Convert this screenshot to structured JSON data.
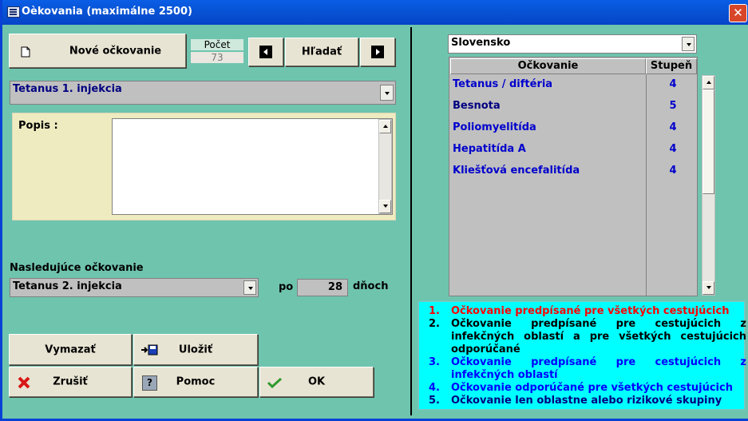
{
  "window": {
    "title": "Oèkovania (maximálne 2500)",
    "close_glyph": "✕"
  },
  "toolbar": {
    "new_label": "Nové očkovanie",
    "count_label": "Počet",
    "count_value": "73",
    "search_label": "Hľadať"
  },
  "vaccine_combo": {
    "value": "Tetanus 1. injekcia"
  },
  "description": {
    "label": "Popis :",
    "value": ""
  },
  "next": {
    "label": "Nasledujúce očkovanie",
    "value": "Tetanus 2. injekcia",
    "after_label": "po",
    "days_value": "28",
    "days_unit": "dňoch"
  },
  "buttons": {
    "delete": "Vymazať",
    "save": "Uložiť",
    "cancel": "Zrušiť",
    "help": "Pomoc",
    "ok": "OK"
  },
  "country_combo": {
    "value": "Slovensko"
  },
  "table": {
    "columns": [
      "Očkovanie",
      "Stupeň"
    ],
    "rows": [
      {
        "name": "Tetanus / diftéria",
        "degree": "4",
        "color": "#0000cc"
      },
      {
        "name": "Besnota",
        "degree": "5",
        "color": "#000080"
      },
      {
        "name": "Poliomyelitída",
        "degree": "4",
        "color": "#0000cc"
      },
      {
        "name": "Hepatitída A",
        "degree": "4",
        "color": "#0000cc"
      },
      {
        "name": "Kliešťová encefalitída",
        "degree": "4",
        "color": "#0000cc"
      }
    ]
  },
  "legend": [
    {
      "num": "1.",
      "text": "Očkovanie predpísané pre všetkých cestujúcich",
      "color": "#ff0000"
    },
    {
      "num": "2.",
      "text": "Očkovanie predpísané pre cestujúcich z infekčných oblastí a pre všetkých cestujúcich odporúčané",
      "color": "#000000"
    },
    {
      "num": "3.",
      "text": "Očkovanie predpísané pre cestujúcich z infekčných oblastí",
      "color": "#0000ff"
    },
    {
      "num": "4.",
      "text": "Očkovanie odporúčané pre všetkých cestujúcich",
      "color": "#0000ff"
    },
    {
      "num": "5.",
      "text": "Očkovanie len oblastne alebo rizikové skupiny",
      "color": "#000080"
    }
  ]
}
